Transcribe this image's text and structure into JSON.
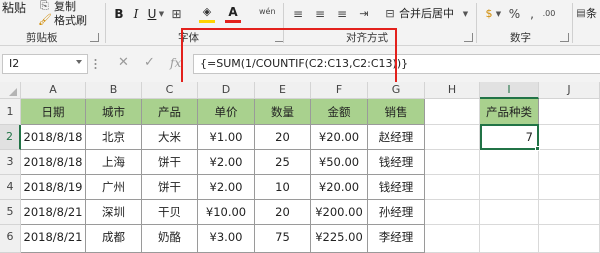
{
  "ribbon": {
    "paste_label": "粘贴",
    "copy_label": "复制",
    "format_painter_label": "格式刷",
    "clipboard_group": "剪贴板",
    "font_group": "字体",
    "alignment_group": "对齐方式",
    "number_group": "数字",
    "merge_center_label": "合并后居中",
    "conditional_label": "条",
    "font_color": "#e3211c",
    "fill_color": "#ffd400"
  },
  "formula_bar": {
    "cell_ref": "I2",
    "formula": "{=SUM(1/COUNTIF(C2:C13,C2:C13))}",
    "fx_label": "fx",
    "highlight_color": "#e3211c"
  },
  "grid": {
    "columns": [
      "A",
      "B",
      "C",
      "D",
      "E",
      "F",
      "G",
      "H",
      "I",
      "J"
    ],
    "rows": [
      "1",
      "2",
      "3",
      "4",
      "5",
      "6"
    ],
    "headers": [
      "日期",
      "城市",
      "产品",
      "单价",
      "数量",
      "金额",
      "销售"
    ],
    "data": [
      [
        "2018/8/18",
        "北京",
        "大米",
        "¥1.00",
        "20",
        "¥20.00",
        "赵经理"
      ],
      [
        "2018/8/18",
        "上海",
        "饼干",
        "¥2.00",
        "25",
        "¥50.00",
        "钱经理"
      ],
      [
        "2018/8/19",
        "广州",
        "饼干",
        "¥2.00",
        "10",
        "¥20.00",
        "钱经理"
      ],
      [
        "2018/8/21",
        "深圳",
        "干贝",
        "¥10.00",
        "20",
        "¥200.00",
        "孙经理"
      ],
      [
        "2018/8/21",
        "成都",
        "奶酪",
        "¥3.00",
        "75",
        "¥225.00",
        "李经理"
      ]
    ],
    "result_header": "产品种类",
    "result_value": "7",
    "header_fill": "#a9d18e"
  }
}
